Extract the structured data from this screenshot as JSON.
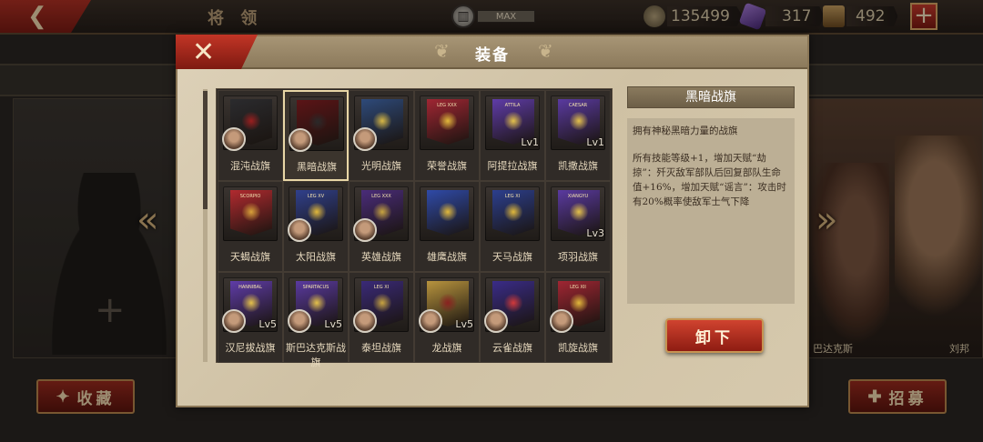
{
  "background": {
    "title": "将 领",
    "max_label": "MAX",
    "resources": {
      "coins": "135499",
      "gems": "317",
      "chests": "492"
    },
    "plus_label": "+",
    "collect_label": "收藏",
    "recruit_label": "招募",
    "hero_labels": [
      "巴达克斯",
      "刘邦"
    ]
  },
  "modal": {
    "title": "装备",
    "close_label": "✕"
  },
  "items": [
    {
      "name": "混沌战旗",
      "level": "",
      "portrait": true,
      "color": "#2b2b2e",
      "emblem": "#9b1f1f",
      "flag_text": ""
    },
    {
      "name": "黑暗战旗",
      "level": "",
      "portrait": true,
      "color": "#5b1416",
      "emblem": "#2a2a2a",
      "flag_text": "",
      "selected": true
    },
    {
      "name": "光明战旗",
      "level": "",
      "portrait": true,
      "color": "#2e4a7a",
      "emblem": "#d8b845",
      "flag_text": ""
    },
    {
      "name": "荣誉战旗",
      "level": "",
      "portrait": false,
      "color": "#a02633",
      "emblem": "#e2b93b",
      "flag_text": "LEG XXX"
    },
    {
      "name": "阿提拉战旗",
      "level": "Lv1",
      "portrait": false,
      "color": "#5f3ca8",
      "emblem": "#e5c24a",
      "flag_text": "ATTILA"
    },
    {
      "name": "凯撒战旗",
      "level": "Lv1",
      "portrait": false,
      "color": "#5a3aa0",
      "emblem": "#e5c24a",
      "flag_text": "CAESAR"
    },
    {
      "name": "天蝎战旗",
      "level": "",
      "portrait": false,
      "color": "#b12a2f",
      "emblem": "#d8a23a",
      "flag_text": "SCORPIO"
    },
    {
      "name": "太阳战旗",
      "level": "",
      "portrait": true,
      "color": "#30408c",
      "emblem": "#e2b93b",
      "flag_text": "LEG XV"
    },
    {
      "name": "英雄战旗",
      "level": "",
      "portrait": true,
      "color": "#4a2c7a",
      "emblem": "#c9a540",
      "flag_text": "LEG XXX"
    },
    {
      "name": "雄鹰战旗",
      "level": "",
      "portrait": false,
      "color": "#2f4aa8",
      "emblem": "#e2b93b",
      "flag_text": ""
    },
    {
      "name": "天马战旗",
      "level": "",
      "portrait": false,
      "color": "#2c3f8e",
      "emblem": "#e2b93b",
      "flag_text": "LEG XI"
    },
    {
      "name": "项羽战旗",
      "level": "Lv3",
      "portrait": false,
      "color": "#5a3aa0",
      "emblem": "#e5c24a",
      "flag_text": "XIANGYU"
    },
    {
      "name": "汉尼拔战旗",
      "level": "Lv5",
      "portrait": true,
      "color": "#5f3ca8",
      "emblem": "#e5c24a",
      "flag_text": "HANNIBAL"
    },
    {
      "name": "斯巴达克斯战旗",
      "level": "Lv5",
      "portrait": true,
      "color": "#5a3aa0",
      "emblem": "#e5c24a",
      "flag_text": "SPARTACUS"
    },
    {
      "name": "泰坦战旗",
      "level": "",
      "portrait": true,
      "color": "#3a2a78",
      "emblem": "#c9a540",
      "flag_text": "LEG XI"
    },
    {
      "name": "龙战旗",
      "level": "Lv5",
      "portrait": true,
      "color": "#b8943e",
      "emblem": "#8a2020",
      "flag_text": ""
    },
    {
      "name": "云雀战旗",
      "level": "",
      "portrait": true,
      "color": "#3a2c88",
      "emblem": "#d33a3a",
      "flag_text": ""
    },
    {
      "name": "凯旋战旗",
      "level": "",
      "portrait": true,
      "color": "#a02633",
      "emblem": "#e2b93b",
      "flag_text": "LEG XII"
    }
  ],
  "detail": {
    "title": "黑暗战旗",
    "desc1": "拥有神秘黑暗力量的战旗",
    "desc2": "所有技能等级+1，增加天赋“劫掠”：歼灭敌军部队后回复部队生命值+16%，增加天赋“谣言”：攻击时有20%概率使敌军士气下降",
    "button_label": "卸下"
  },
  "colors": {
    "accent_red": "#c23526",
    "gold_border": "#c69452",
    "parchment": "#d8cbb0"
  }
}
